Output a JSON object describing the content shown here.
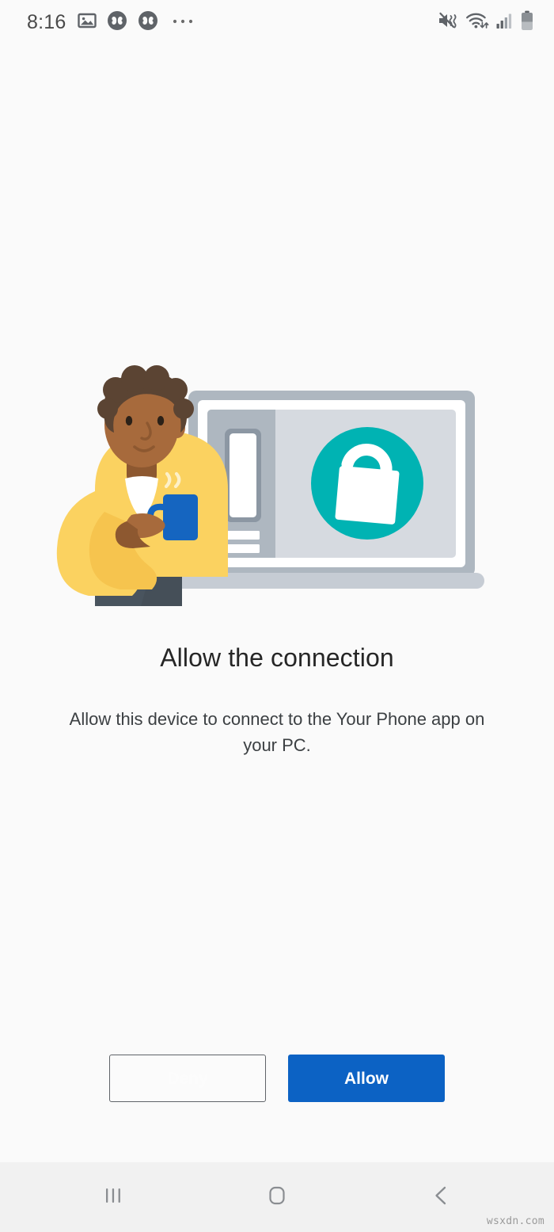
{
  "status_bar": {
    "time": "8:16",
    "left_icons": [
      {
        "name": "image-icon",
        "label": "Screenshot"
      },
      {
        "name": "clover-notification-icon-1",
        "label": "App notification"
      },
      {
        "name": "clover-notification-icon-2",
        "label": "App notification"
      },
      {
        "name": "more-notifications-icon",
        "label": "More notifications"
      }
    ],
    "right_icons": [
      {
        "name": "mute-vibrate-icon",
        "label": "Sound off / vibrate"
      },
      {
        "name": "wifi-icon",
        "label": "Wi-Fi connected"
      },
      {
        "name": "signal-icon",
        "label": "Cellular signal"
      },
      {
        "name": "battery-icon",
        "label": "Battery"
      }
    ]
  },
  "illustration": {
    "name": "allow-connection-illustration",
    "alt": "Person holding a coffee mug next to a laptop showing a phone and an unlocked padlock",
    "colors": {
      "skin": "#a76a3c",
      "hair": "#5b4433",
      "sweater": "#fbd260",
      "sweater_shade": "#f6c44e",
      "collar": "#ffffff",
      "pants": "#49545e",
      "mug": "#1565c0",
      "laptop_frame": "#aeb7c0",
      "laptop_inner": "#ffffff",
      "screen_left": "#aeb7c0",
      "screen_right": "#d6dae0",
      "phone_body": "#8c97a3",
      "phone_screen": "#ffffff",
      "lock_circle": "#00b3b3",
      "lock_body": "#ffffff",
      "laptop_base": "#c6ccd4"
    }
  },
  "main": {
    "title": "Allow the connection",
    "subtitle": "Allow this device to connect to the Your Phone app on your PC."
  },
  "actions": {
    "deny_label": "Deny",
    "allow_label": "Allow",
    "allow_color": "#0c62c4",
    "deny_border_color": "#5f6368"
  },
  "nav_bar": {
    "recents_label": "Recent apps",
    "home_label": "Home",
    "back_label": "Back"
  },
  "watermark": {
    "text": "wsxdn.com"
  }
}
